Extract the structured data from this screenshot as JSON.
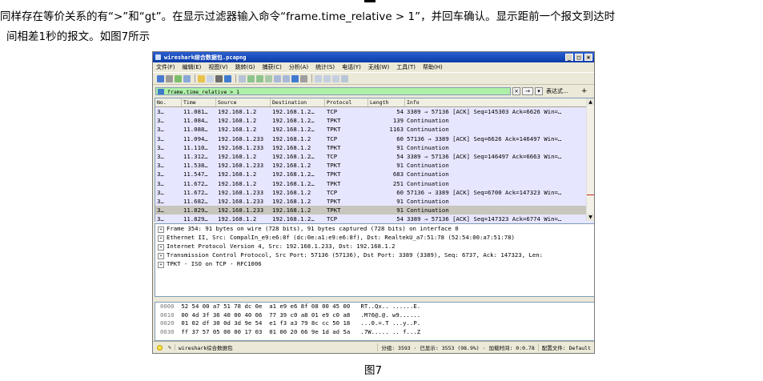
{
  "article": {
    "line1": "同样存在等价关系的有“>”和“gt”。在显示过滤器输入命令“frame.time_relative > 1”，并回车确认。显示距前一个报文到达时",
    "line2": "间相差1秒的报文。如图7所示",
    "caption": "图7"
  },
  "window": {
    "title": "wireshark综合数据包.pcapng",
    "controls": [
      "_",
      "□",
      "×"
    ]
  },
  "menu": [
    "文件(F)",
    "编辑(E)",
    "视图(V)",
    "跳转(G)",
    "捕获(C)",
    "分析(A)",
    "统计(S)",
    "电话(Y)",
    "无线(W)",
    "工具(T)",
    "帮助(H)"
  ],
  "filter": {
    "value": "frame.time_relative > 1",
    "expression_label": "表达式…",
    "plus": "+"
  },
  "columns": [
    "No.",
    "Time",
    "Source",
    "Destination",
    "Protocol",
    "Length",
    "Info"
  ],
  "packets": [
    {
      "no": "3…",
      "time": "11.081…",
      "src": "192.168.1.2",
      "dst": "192.168.1.2…",
      "proto": "TCP",
      "len": "54",
      "info": "3389 → 57136 [ACK] Seq=145303 Ack=6626 Win=…",
      "sel": false
    },
    {
      "no": "3…",
      "time": "11.084…",
      "src": "192.168.1.2",
      "dst": "192.168.1.2…",
      "proto": "TPKT",
      "len": "139",
      "info": "Continuation",
      "sel": false
    },
    {
      "no": "3…",
      "time": "11.088…",
      "src": "192.168.1.2",
      "dst": "192.168.1.2…",
      "proto": "TPKT",
      "len": "1163",
      "info": "Continuation",
      "sel": false
    },
    {
      "no": "3…",
      "time": "11.094…",
      "src": "192.168.1.233",
      "dst": "192.168.1.2",
      "proto": "TCP",
      "len": "60",
      "info": "57136 → 3389 [ACK] Seq=6626 Ack=146497 Win=…",
      "sel": false
    },
    {
      "no": "3…",
      "time": "11.110…",
      "src": "192.168.1.233",
      "dst": "192.168.1.2",
      "proto": "TPKT",
      "len": "91",
      "info": "Continuation",
      "sel": false
    },
    {
      "no": "3…",
      "time": "11.312…",
      "src": "192.168.1.2",
      "dst": "192.168.1.2…",
      "proto": "TCP",
      "len": "54",
      "info": "3389 → 57136 [ACK] Seq=146497 Ack=6663 Win=…",
      "sel": false
    },
    {
      "no": "3…",
      "time": "11.538…",
      "src": "192.168.1.233",
      "dst": "192.168.1.2",
      "proto": "TPKT",
      "len": "91",
      "info": "Continuation",
      "sel": false
    },
    {
      "no": "3…",
      "time": "11.547…",
      "src": "192.168.1.2",
      "dst": "192.168.1.2…",
      "proto": "TPKT",
      "len": "683",
      "info": "Continuation",
      "sel": false
    },
    {
      "no": "3…",
      "time": "11.672…",
      "src": "192.168.1.2",
      "dst": "192.168.1.2…",
      "proto": "TPKT",
      "len": "251",
      "info": "Continuation",
      "sel": false
    },
    {
      "no": "3…",
      "time": "11.672…",
      "src": "192.168.1.233",
      "dst": "192.168.1.2",
      "proto": "TCP",
      "len": "60",
      "info": "57136 → 3389 [ACK] Seq=6700 Ack=147323 Win=…",
      "sel": false
    },
    {
      "no": "3…",
      "time": "11.682…",
      "src": "192.168.1.233",
      "dst": "192.168.1.2",
      "proto": "TPKT",
      "len": "91",
      "info": "Continuation",
      "sel": false
    },
    {
      "no": "3…",
      "time": "11.829…",
      "src": "192.168.1.233",
      "dst": "192.168.1.2",
      "proto": "TPKT",
      "len": "91",
      "info": "Continuation",
      "sel": true
    },
    {
      "no": "3…",
      "time": "11.829…",
      "src": "192.168.1.2",
      "dst": "192.168.1.2…",
      "proto": "TCP",
      "len": "54",
      "info": "3389 → 57136 [ACK] Seq=147323 Ack=6774 Win=…",
      "sel": false
    }
  ],
  "details": [
    "Frame 354: 91 bytes on wire (728 bits), 91 bytes captured (728 bits) on interface 0",
    "Ethernet II, Src: CompalIn_e9:e6:8f (dc:0e:a1:e9:e6:8f), Dst: RealtekU_a7:51:78 (52:54:00:a7:51:78)",
    "Internet Protocol Version 4, Src: 192.168.1.233, Dst: 192.168.1.2",
    "Transmission Control Protocol, Src Port: 57136 (57136), Dst Port: 3389 (3389), Seq: 6737, Ack: 147323, Len:",
    "TPKT - ISO on TCP - RFC1006"
  ],
  "bytes": [
    {
      "off": "0000",
      "hex": "52 54 00 a7 51 78 dc 0e  a1 e9 e6 8f 08 00 45 00",
      "ascii": "RT..Qx.. ......E."
    },
    {
      "off": "0010",
      "hex": "00 4d 3f 36 40 00 40 06  77 39 c0 a8 01 e9 c0 a8",
      "ascii": ".M?6@.@. w9......"
    },
    {
      "off": "0020",
      "hex": "01 02 df 30 0d 3d 9e 54  e1 f3 a3 79 8c cc 50 18",
      "ascii": "...0.=.T ...y..P."
    },
    {
      "off": "0030",
      "hex": "ff 37 57 05 00 00 17 03  01 00 20 66 9e 1d ad 5a",
      "ascii": ".7W..... .. f...Z"
    }
  ],
  "status": {
    "file": "wireshark综合数据包",
    "groups": "分组: 3593 · 已显示: 3553 (98.9%) · 加载时间: 0:0.78",
    "profile": "配置文件: Default"
  },
  "colors": {
    "filter_ok": "#aff0a8",
    "row_tcp": "#e7e6ff",
    "row_selected": "#c8c6bd"
  }
}
